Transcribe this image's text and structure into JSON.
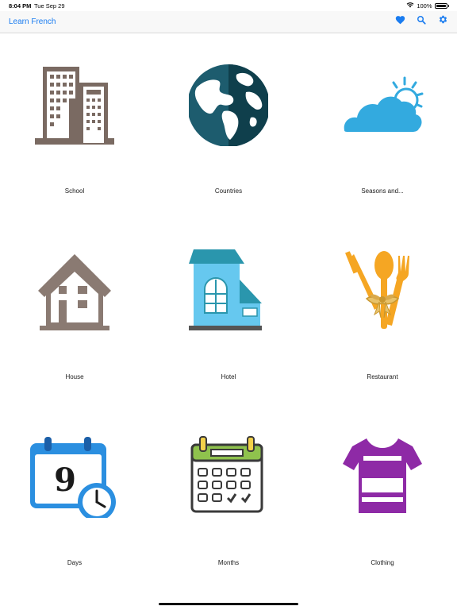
{
  "status_bar": {
    "time": "8:04 PM",
    "date": "Tue Sep 29",
    "battery_text": "100%",
    "battery_level": 1.0
  },
  "nav": {
    "title": "Learn French",
    "accent_color": "#1a7cf0",
    "icons": [
      "heart-icon",
      "search-icon",
      "gear-icon"
    ]
  },
  "categories": [
    {
      "label": "School",
      "icon": "school-building-icon"
    },
    {
      "label": "Countries",
      "icon": "globe-icon"
    },
    {
      "label": "Seasons and...",
      "icon": "weather-cloud-sun-icon"
    },
    {
      "label": "House",
      "icon": "house-icon"
    },
    {
      "label": "Hotel",
      "icon": "hotel-icon"
    },
    {
      "label": "Restaurant",
      "icon": "cutlery-icon"
    },
    {
      "label": "Days",
      "icon": "calendar-clock-icon"
    },
    {
      "label": "Months",
      "icon": "calendar-month-icon"
    },
    {
      "label": "Clothing",
      "icon": "tshirt-icon"
    }
  ]
}
